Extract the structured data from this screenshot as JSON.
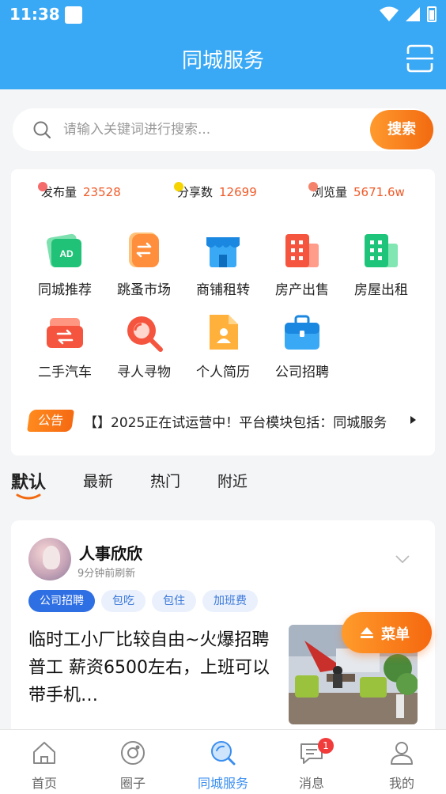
{
  "status_bar": {
    "time": "11:38"
  },
  "header": {
    "title": "同城服务"
  },
  "search": {
    "placeholder": "请输入关键词进行搜索...",
    "button_label": "搜索"
  },
  "stats": [
    {
      "label": "发布量",
      "value": "23528",
      "dot_color": "#f56b6b"
    },
    {
      "label": "分享数",
      "value": "12699",
      "dot_color": "#f5d400"
    },
    {
      "label": "浏览量",
      "value": "5671.6w",
      "dot_color": "#f5836b"
    }
  ],
  "categories": [
    {
      "label": "同城推荐",
      "icon": "ad-card-icon",
      "color": "#22c67a"
    },
    {
      "label": "跳蚤市场",
      "icon": "exchange-tag-icon",
      "color": "#ff8b3d"
    },
    {
      "label": "商铺租转",
      "icon": "storefront-icon",
      "color": "#3aa9f5"
    },
    {
      "label": "房产出售",
      "icon": "building-icon",
      "color": "#f5553f"
    },
    {
      "label": "房屋出租",
      "icon": "building-icon",
      "color": "#1ec47a"
    },
    {
      "label": "二手汽车",
      "icon": "car-exchange-icon",
      "color": "#f5553f"
    },
    {
      "label": "寻人寻物",
      "icon": "magnifier-icon",
      "color": "#f5553f"
    },
    {
      "label": "个人简历",
      "icon": "resume-icon",
      "color": "#ffb13b"
    },
    {
      "label": "公司招聘",
      "icon": "briefcase-icon",
      "color": "#3aa9f5"
    }
  ],
  "notice": {
    "tag": "公告",
    "text": "【】2025正在试运营中！平台模块包括：同城服务"
  },
  "tabs": [
    "默认",
    "最新",
    "热门",
    "附近"
  ],
  "post": {
    "user_name": "人事欣欣",
    "time": "9分钟前刷新",
    "tags": [
      "公司招聘",
      "包吃",
      "包住",
      "加班费"
    ],
    "title": "临时工小厂比较自由~火爆招聘普工 薪资6500左右，上班可以带手机…"
  },
  "fab": {
    "label": "菜单"
  },
  "bottom_nav": [
    {
      "label": "首页",
      "icon": "home-icon"
    },
    {
      "label": "圈子",
      "icon": "circle-icon"
    },
    {
      "label": "同城服务",
      "icon": "search-globe-icon"
    },
    {
      "label": "消息",
      "icon": "chat-icon",
      "badge": "1"
    },
    {
      "label": "我的",
      "icon": "user-icon"
    }
  ],
  "colors": {
    "brand_blue": "#3aa9f5",
    "accent_orange": "#f26a10",
    "nav_active": "#3a8ef0"
  }
}
